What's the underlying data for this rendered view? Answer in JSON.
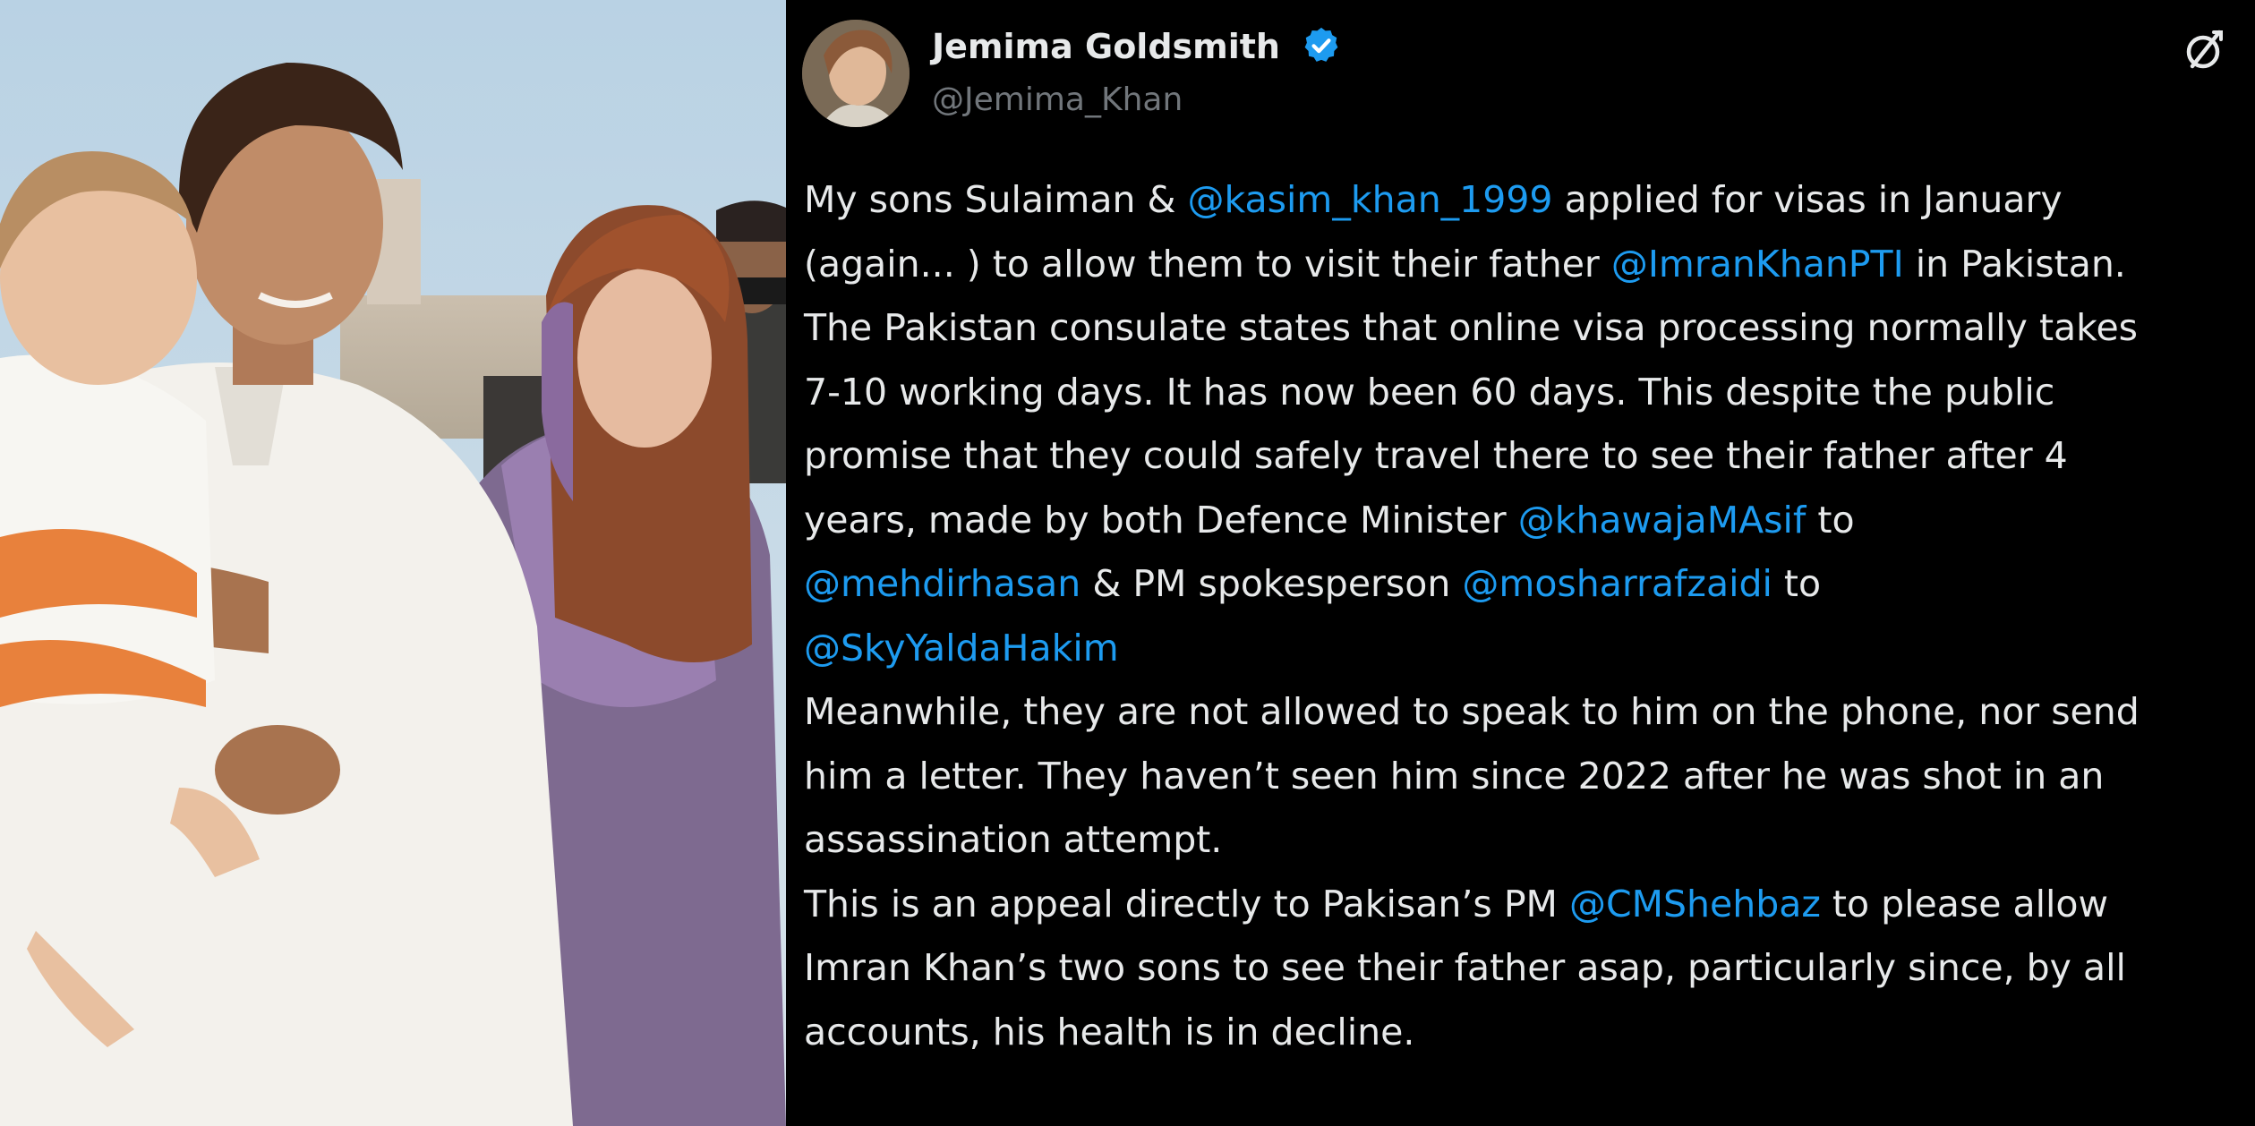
{
  "tweet": {
    "author": {
      "name": "Jemima Goldsmith",
      "handle": "@Jemima_Khan",
      "verified": true
    },
    "lines": [
      [
        {
          "t": "My sons Sulaiman & "
        },
        {
          "t": "@kasim_khan_1999",
          "m": true
        },
        {
          "t": " applied for visas in January"
        }
      ],
      [
        {
          "t": "(again... ) to allow them to visit their father "
        },
        {
          "t": "@ImranKhanPTI",
          "m": true
        },
        {
          "t": " in Pakistan."
        }
      ],
      [
        {
          "t": "The Pakistan consulate states that online visa processing normally takes"
        }
      ],
      [
        {
          "t": "7-10 working days. It has now been 60 days. This despite the public"
        }
      ],
      [
        {
          "t": "promise that they could safely travel there to see their father after 4"
        }
      ],
      [
        {
          "t": "years, made by both Defence Minister  "
        },
        {
          "t": "@khawajaMAsif",
          "m": true
        },
        {
          "t": " to"
        }
      ],
      [
        {
          "t": "@mehdirhasan",
          "m": true
        },
        {
          "t": " & PM spokesperson "
        },
        {
          "t": "@mosharrafzaidi",
          "m": true
        },
        {
          "t": " to"
        }
      ],
      [
        {
          "t": "@SkyYaldaHakim",
          "m": true
        }
      ],
      [
        {
          "t": "Meanwhile, they are not allowed to speak to him on the phone, nor send"
        }
      ],
      [
        {
          "t": "him a letter. They haven’t seen him since 2022 after he was shot in an"
        }
      ],
      [
        {
          "t": "assassination attempt."
        }
      ],
      [
        {
          "t": "This is an appeal directly to Pakisan’s PM "
        },
        {
          "t": "@CMShehbaz",
          "m": true
        },
        {
          "t": " to please allow"
        }
      ],
      [
        {
          "t": "Imran Khan’s two sons to see their father asap, particularly since, by all"
        }
      ],
      [
        {
          "t": "accounts, his health is in decline."
        }
      ]
    ]
  },
  "icons": {
    "verified": "verified-badge-icon",
    "grok": "grok-icon"
  },
  "colors": {
    "background": "#000000",
    "text": "#e7e9ea",
    "handle": "#71767b",
    "mention": "#1d9bf0",
    "verified": "#1d9bf0"
  }
}
